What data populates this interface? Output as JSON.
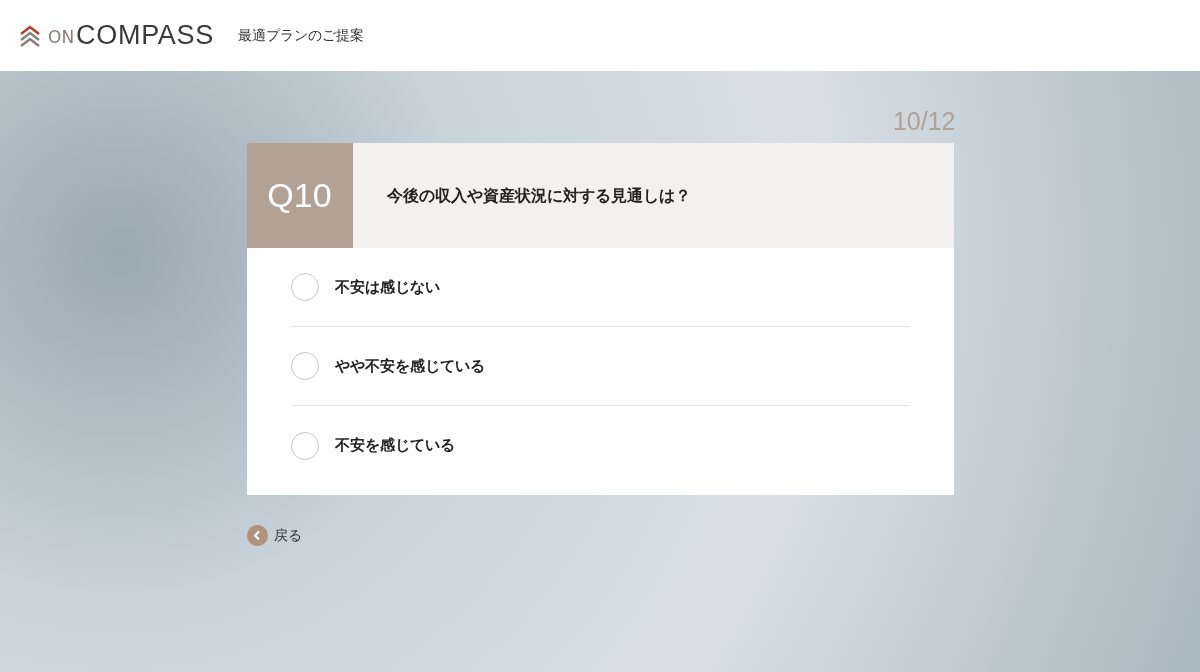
{
  "header": {
    "logo_prefix": "ON",
    "logo_name": "COMPASS",
    "title": "最適プランのご提案"
  },
  "progress": "10/12",
  "question": {
    "number": "Q10",
    "text": "今後の収入や資産状況に対する見通しは？",
    "options": [
      {
        "label": "不安は感じない",
        "selected": false
      },
      {
        "label": "やや不安を感じている",
        "selected": false
      },
      {
        "label": "不安を感じている",
        "selected": false
      }
    ]
  },
  "back": "戻る"
}
